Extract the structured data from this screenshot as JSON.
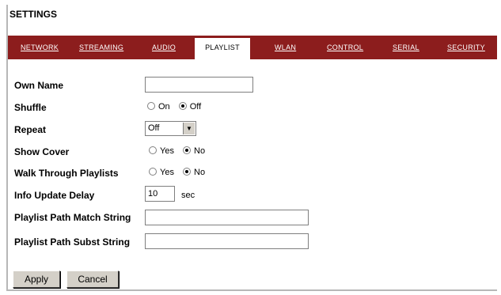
{
  "page": {
    "title": "SETTINGS"
  },
  "tabs": [
    {
      "label": "NETWORK",
      "active": false
    },
    {
      "label": "STREAMING",
      "active": false
    },
    {
      "label": "AUDIO",
      "active": false
    },
    {
      "label": "PLAYLIST",
      "active": true
    },
    {
      "label": "WLAN",
      "active": false
    },
    {
      "label": "CONTROL",
      "active": false
    },
    {
      "label": "SERIAL",
      "active": false
    },
    {
      "label": "SECURITY",
      "active": false
    }
  ],
  "form": {
    "own_name": {
      "label": "Own Name",
      "value": ""
    },
    "shuffle": {
      "label": "Shuffle",
      "options": [
        "On",
        "Off"
      ],
      "selected": "Off"
    },
    "repeat": {
      "label": "Repeat",
      "value": "Off"
    },
    "show_cover": {
      "label": "Show Cover",
      "options": [
        "Yes",
        "No"
      ],
      "selected": "No"
    },
    "walk_through": {
      "label": "Walk Through Playlists",
      "options": [
        "Yes",
        "No"
      ],
      "selected": "No"
    },
    "info_update_delay": {
      "label": "Info Update Delay",
      "value": "10",
      "unit": "sec"
    },
    "match_string": {
      "label": "Playlist Path Match String",
      "value": ""
    },
    "subst_string": {
      "label": "Playlist Path Subst String",
      "value": ""
    }
  },
  "buttons": {
    "apply": "Apply",
    "cancel": "Cancel"
  },
  "colors": {
    "tabbar": "#8c1d1d",
    "tab_text": "#ffffff"
  }
}
